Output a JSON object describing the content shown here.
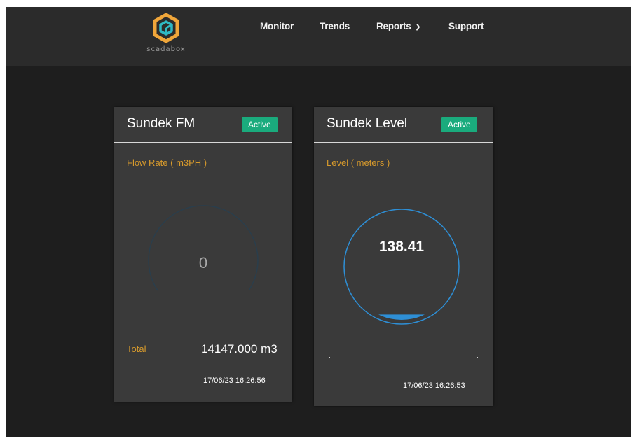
{
  "app": {
    "logo_text": "scadabox",
    "nav": [
      {
        "label": "Monitor"
      },
      {
        "label": "Trends"
      },
      {
        "label": "Reports"
      },
      {
        "label": "Support"
      }
    ]
  },
  "cards": [
    {
      "title": "Sundek FM",
      "status": "Active",
      "label": "Flow Rate ( m3PH )",
      "value": "0",
      "total_label": "Total",
      "total_value": "14147.000 m3",
      "timestamp": "17/06/23 16:26:56"
    },
    {
      "title": "Sundek Level",
      "status": "Active",
      "label": "Level ( meters )",
      "value": "138.41",
      "fill_fraction": 0.05,
      "timestamp": "17/06/23 16:26:53"
    }
  ],
  "colors": {
    "accent_label": "#d79a2c",
    "active_badge": "#1aab7d",
    "gauge_blue": "#2e8fd6",
    "logo_orange": "#f0a63a",
    "logo_teal": "#2fb8c4"
  },
  "icons": {
    "logo": "scadabox-logo-icon",
    "reports_menu": "chevron-down-icon"
  }
}
